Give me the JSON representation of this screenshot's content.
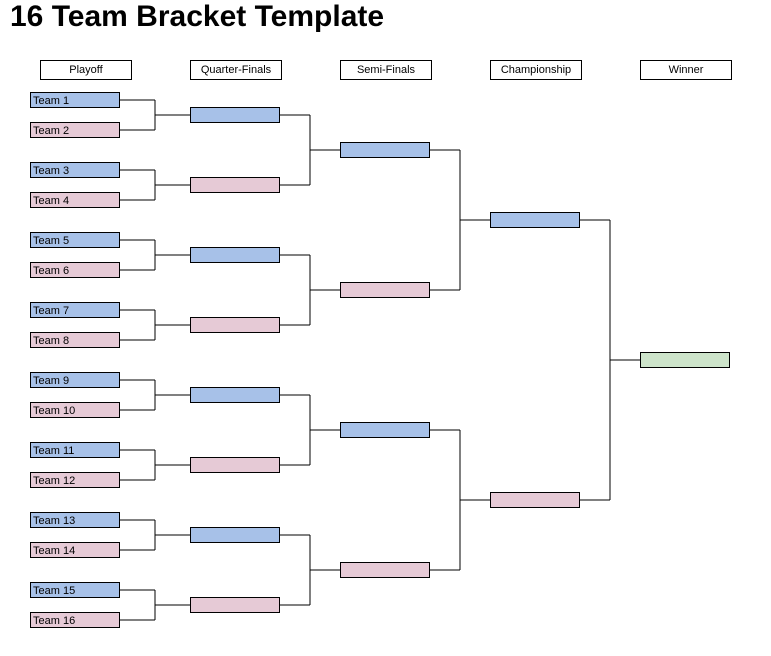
{
  "title": "16 Team Bracket Template",
  "columns": {
    "playoff": "Playoff",
    "quarter": "Quarter-Finals",
    "semi": "Semi-Finals",
    "champ": "Championship",
    "winner": "Winner"
  },
  "teams": {
    "t1": "Team 1",
    "t2": "Team 2",
    "t3": "Team 3",
    "t4": "Team 4",
    "t5": "Team 5",
    "t6": "Team 6",
    "t7": "Team 7",
    "t8": "Team 8",
    "t9": "Team 9",
    "t10": "Team 10",
    "t11": "Team 11",
    "t12": "Team 12",
    "t13": "Team 13",
    "t14": "Team 14",
    "t15": "Team 15",
    "t16": "Team 16"
  },
  "colors": {
    "blue": "#a7c1e8",
    "pink": "#e6cad6",
    "green": "#cde4ca"
  }
}
